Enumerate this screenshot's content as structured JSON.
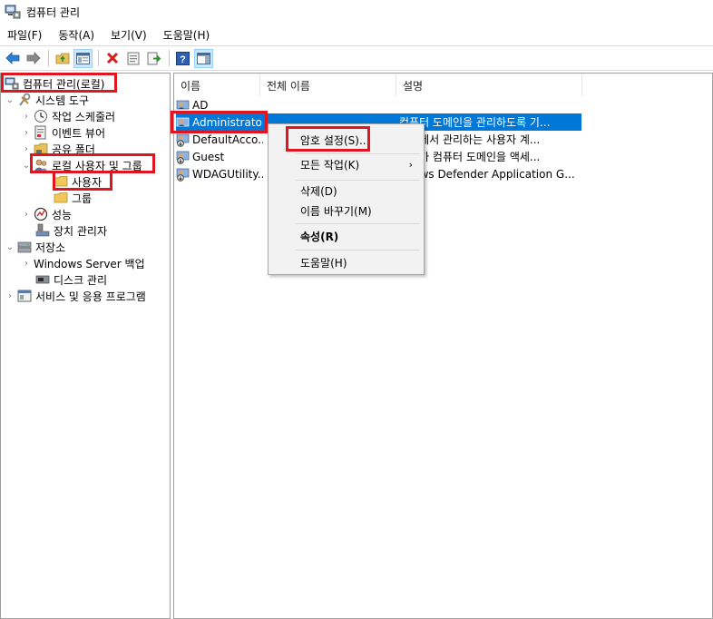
{
  "window": {
    "title": "컴퓨터 관리"
  },
  "menu": [
    "파일(F)",
    "동작(A)",
    "보기(V)",
    "도움말(H)"
  ],
  "toolbar": {
    "icons": [
      "back-icon",
      "forward-icon",
      "up-folder-icon",
      "show-tree-icon",
      "delete-icon",
      "properties-icon",
      "export-icon",
      "help-icon",
      "show-action-pane-icon"
    ]
  },
  "tree": {
    "root": "컴퓨터 관리(로컬)",
    "system_tools": "시스템 도구",
    "task_scheduler": "작업 스케줄러",
    "event_viewer": "이벤트 뷰어",
    "shared_folders": "공유 폴더",
    "local_users_groups": "로컬 사용자 및 그룹",
    "users": "사용자",
    "groups": "그룹",
    "performance": "성능",
    "device_manager": "장치 관리자",
    "storage": "저장소",
    "windows_server_backup": "Windows Server 백업",
    "disk_management": "디스크 관리",
    "services_apps": "서비스 및 응용 프로그램"
  },
  "list": {
    "columns": [
      "이름",
      "전체 이름",
      "설명"
    ],
    "rows": [
      {
        "name": "AD",
        "full": "",
        "desc": ""
      },
      {
        "name": "Administrator",
        "full": "",
        "desc": "컴퓨터 도메인을 관리하도록 기..."
      },
      {
        "name": "DefaultAcco...",
        "full": "",
        "desc": "스템에서 관리하는 사용자 계..."
      },
      {
        "name": "Guest",
        "full": "",
        "desc": "스트가 컴퓨터 도메인을 액세..."
      },
      {
        "name": "WDAGUtility...",
        "full": "",
        "desc": "ndows Defender Application G..."
      }
    ]
  },
  "context_menu": {
    "set_password": "암호 설정(S)...",
    "all_tasks": "모든 작업(K)",
    "delete": "삭제(D)",
    "rename": "이름 바꾸기(M)",
    "properties": "속성(R)",
    "help": "도움말(H)",
    "submenu_arrow": "›"
  },
  "colors": {
    "selection": "#0078d7",
    "highlight": "#e0151f",
    "menu_bg": "#f2f2f2"
  }
}
